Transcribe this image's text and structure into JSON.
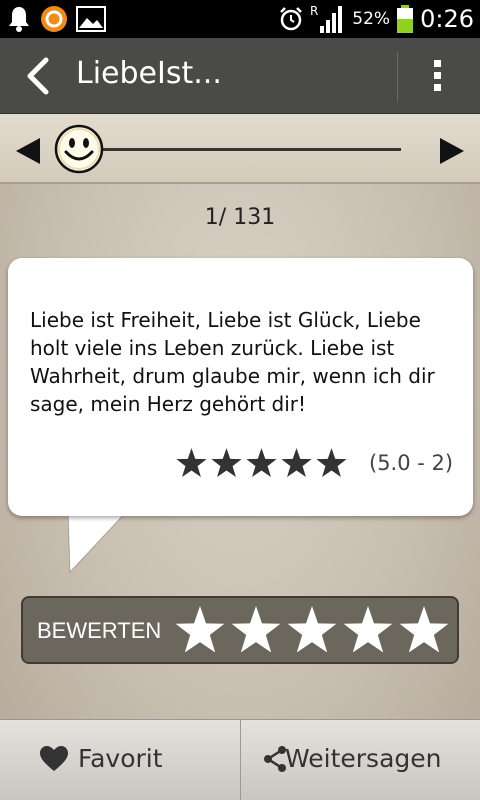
{
  "status_bar": {
    "time": "0:26",
    "battery_percent": "52%",
    "roaming": "R",
    "icons": [
      "notification-bell-icon",
      "orange-app-icon",
      "image-icon",
      "alarm-clock-icon",
      "signal-icon",
      "battery-icon"
    ]
  },
  "action_bar": {
    "title": "LiebeIst...",
    "back_icon": "chevron-left-icon",
    "overflow_icon": "overflow-menu-icon"
  },
  "slider": {
    "thumb_icon": "smiley-face-icon",
    "prev_icon": "triangle-left-icon",
    "next_icon": "triangle-right-icon"
  },
  "counter": "1/ 131",
  "quote": {
    "text": "Liebe ist Freiheit, Liebe ist Glück, Liebe holt viele ins Leben zurück. Liebe ist Wahrheit, drum glaube mir, wenn ich dir sage, mein Herz gehört dir!",
    "rating_stars": 5,
    "rating_label": "(5.0 - 2)"
  },
  "bewerten": {
    "label": "BEWERTEN",
    "star_count": 5
  },
  "bottom_bar": {
    "favorite_label": "Favorit",
    "share_label": "Weitersagen"
  },
  "colors": {
    "action_bar": "#4a4a48",
    "bewerten_bar": "#6b675d",
    "background": "#c9bfb0"
  }
}
